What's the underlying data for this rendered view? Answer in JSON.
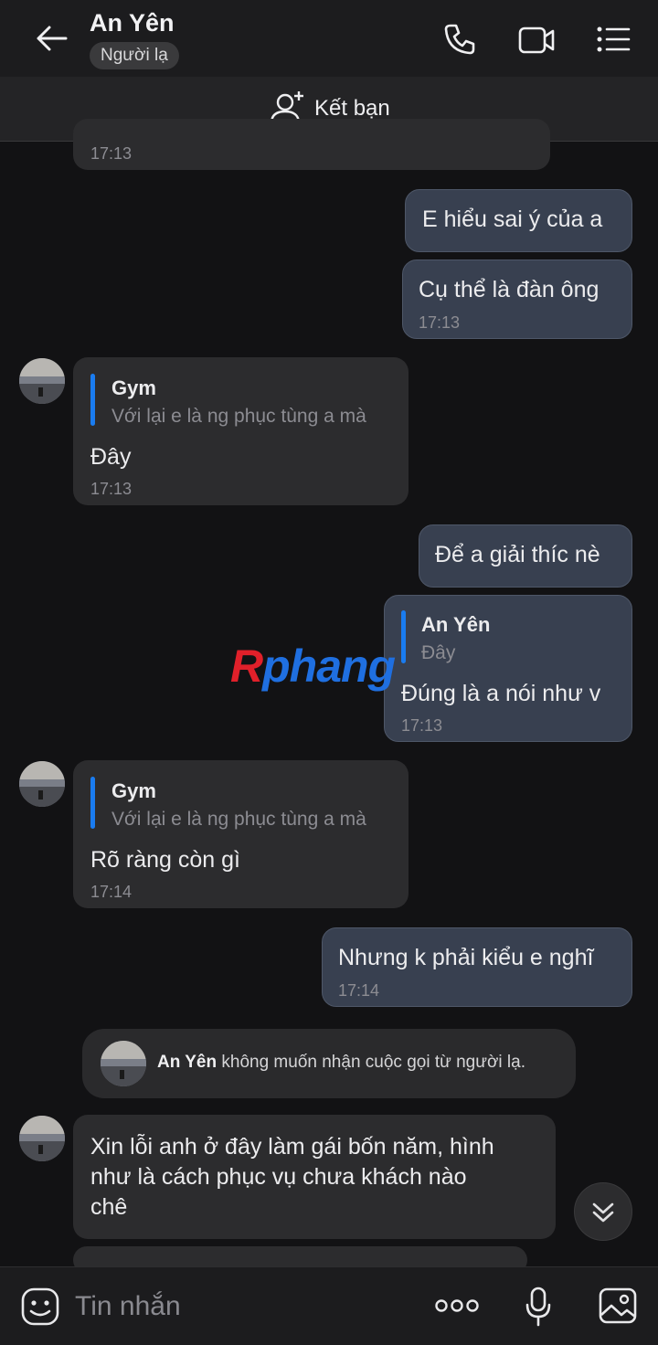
{
  "header": {
    "title": "An Yên",
    "badge": "Người lạ"
  },
  "friend_bar": {
    "label": "Kết bạn"
  },
  "messages": [
    {
      "from": "contact",
      "time": "17:13"
    },
    {
      "from": "me",
      "text": "E hiểu sai ý của a"
    },
    {
      "from": "me",
      "text": "Cụ thể là đàn ông",
      "time": "17:13"
    },
    {
      "from": "contact",
      "quote_name": "Gym",
      "quote_text": "Với lại e là ng phục tùng a mà",
      "text": "Đây",
      "time": "17:13"
    },
    {
      "from": "me",
      "text": "Để a giải thíc nè"
    },
    {
      "from": "me",
      "quote_name": "An Yên",
      "quote_text": "Đây",
      "text": "Đúng là a nói như v",
      "time": "17:13"
    },
    {
      "from": "contact",
      "quote_name": "Gym",
      "quote_text": "Với lại e là ng phục tùng a mà",
      "text": "Rõ ràng còn gì",
      "time": "17:14"
    },
    {
      "from": "me",
      "text": "Nhưng k phải kiểu e nghĩ",
      "time": "17:14"
    },
    {
      "from": "contact",
      "text_lines": [
        "Xin lỗi anh ở đây làm gái bốn năm, hình",
        "như là cách phục vụ chưa khách nào",
        "chê"
      ]
    }
  ],
  "system_note": {
    "name": "An Yên",
    "text": "không muốn nhận cuộc gọi từ người lạ."
  },
  "watermark": {
    "red": "R",
    "blue": "phang"
  },
  "composer": {
    "placeholder": "Tin nhắn"
  },
  "colors": {
    "accent": "#1a7cf0",
    "background": "#121214",
    "outgoing_bubble": "#384050",
    "incoming_bubble": "#2c2c2e"
  }
}
